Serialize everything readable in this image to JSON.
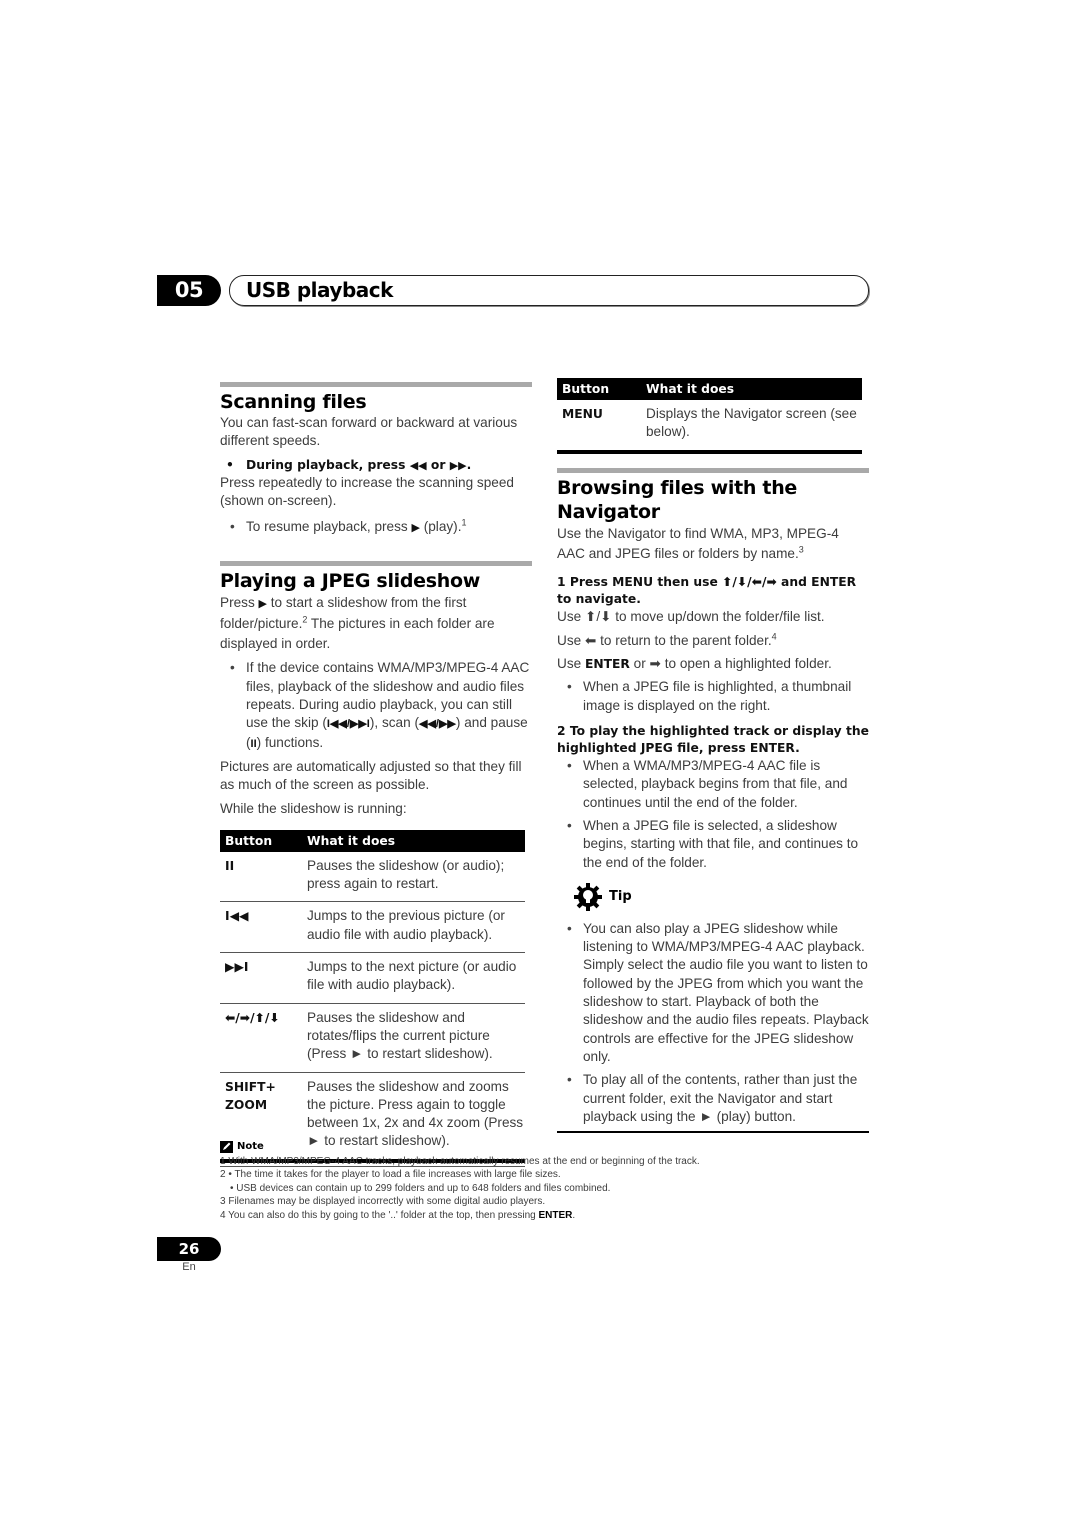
{
  "chapter": {
    "number": "05",
    "title": "USB playback"
  },
  "scanning": {
    "title": "Scanning files",
    "intro": "You can fast-scan forward or backward at various different speeds.",
    "step_prefix": "During playback, press ",
    "step_icon1": "◀◀",
    "step_or": " or ",
    "step_icon2": "▶▶",
    "step_suffix": ".",
    "step_detail": "Press repeatedly to increase the scanning speed (shown on-screen).",
    "bullet_prefix": "To resume playback, press ",
    "bullet_icon": "▶",
    "bullet_suffix": " (play).",
    "bullet_footnote": "1"
  },
  "jpeg": {
    "title": "Playing a JPEG slideshow",
    "intro_prefix": "Press ",
    "intro_icon": "▶",
    "intro_mid": " to start a slideshow from the first folder/picture.",
    "intro_footnote": "2",
    "intro_suffix": " The pictures in each folder are displayed in order.",
    "bullet_a": "If the device contains WMA/MP3/MPEG-4 AAC files, playback of the slideshow and audio files repeats. During audio playback, you can still use the skip (",
    "bullet_skip": "I◀◀/▶▶I",
    "bullet_b": "), scan (",
    "bullet_scan": "◀◀/▶▶",
    "bullet_c": ") and pause (",
    "bullet_pause": "II",
    "bullet_d": ") functions.",
    "adjust": "Pictures are automatically adjusted so that they fill as much of the screen as possible.",
    "while": "While the slideshow is running:",
    "table": {
      "headers": [
        "Button",
        "What it does"
      ],
      "rows": [
        {
          "button": "II",
          "desc": "Pauses the slideshow (or audio); press again to restart."
        },
        {
          "button": "I◀◀",
          "desc": "Jumps to the previous picture (or audio file with audio playback)."
        },
        {
          "button": "▶▶I",
          "desc": "Jumps to the next picture (or audio file with audio playback)."
        },
        {
          "button": "⬅/➡/⬆/⬇",
          "desc": "Pauses the slideshow and rotates/flips the current picture (Press ► to restart slideshow)."
        },
        {
          "button": "SHIFT+ ZOOM",
          "desc": "Pauses the slideshow and zooms the picture. Press again to toggle between 1x, 2x and 4x zoom (Press ► to restart slideshow)."
        }
      ]
    }
  },
  "menu_table": {
    "headers": [
      "Button",
      "What it does"
    ],
    "rows": [
      {
        "button": "MENU",
        "desc": "Displays the Navigator screen (see below)."
      }
    ]
  },
  "navigator": {
    "title": "Browsing files with the Navigator",
    "intro": "Use the Navigator to find WMA, MP3, MPEG-4 AAC and JPEG files or folders by name.",
    "intro_footnote": "3",
    "step1": "1   Press MENU then use ⬆/⬇/⬅/➡ and ENTER to navigate.",
    "line1": "Use ⬆/⬇ to move up/down the folder/file list.",
    "line2_prefix": "Use ⬅ to return to the parent folder.",
    "line2_footnote": "4",
    "line3_prefix": "Use ",
    "line3_bold": "ENTER",
    "line3_suffix": " or ➡ to open a highlighted folder.",
    "bullet1": "When a JPEG file is highlighted, a thumbnail image is displayed on the right.",
    "step2": "2   To play the highlighted track or display the highlighted JPEG file, press ENTER.",
    "bullet2": "When a WMA/MP3/MPEG-4 AAC file is selected, playback begins from that file, and continues until the end of the folder.",
    "bullet3": "When a JPEG file is selected, a slideshow begins, starting with that file, and continues to the end of the folder."
  },
  "tip": {
    "label": "Tip",
    "icon": "lightbulb-gear-icon",
    "bullet1": "You can also play a JPEG slideshow while listening to WMA/MP3/MPEG-4 AAC playback. Simply select the audio file you want to listen to followed by the JPEG from which you want the slideshow to start. Playback of both the slideshow and the audio files repeats. Playback controls are effective for the JPEG slideshow only.",
    "bullet2": "To play all of the contents, rather than just the current folder, exit the Navigator and start playback using the ► (play) button."
  },
  "notes": {
    "label": "Note",
    "icon": "pencil-icon",
    "items": [
      "1 With WMA/MP3/MPEG-4 AAC tracks, playback automatically resumes at the end or beginning of the track.",
      "2 • The time it takes for the player to load a file increases with large file sizes.",
      "• USB devices can contain up to 299 folders and up to 648 folders and files combined.",
      "3 Filenames may be displayed incorrectly with some digital audio players."
    ],
    "item4_prefix": "4 You can also do this by going to the '..' folder at the top, then pressing ",
    "item4_bold": "ENTER",
    "item4_suffix": "."
  },
  "footer": {
    "page": "26",
    "lang": "En"
  }
}
